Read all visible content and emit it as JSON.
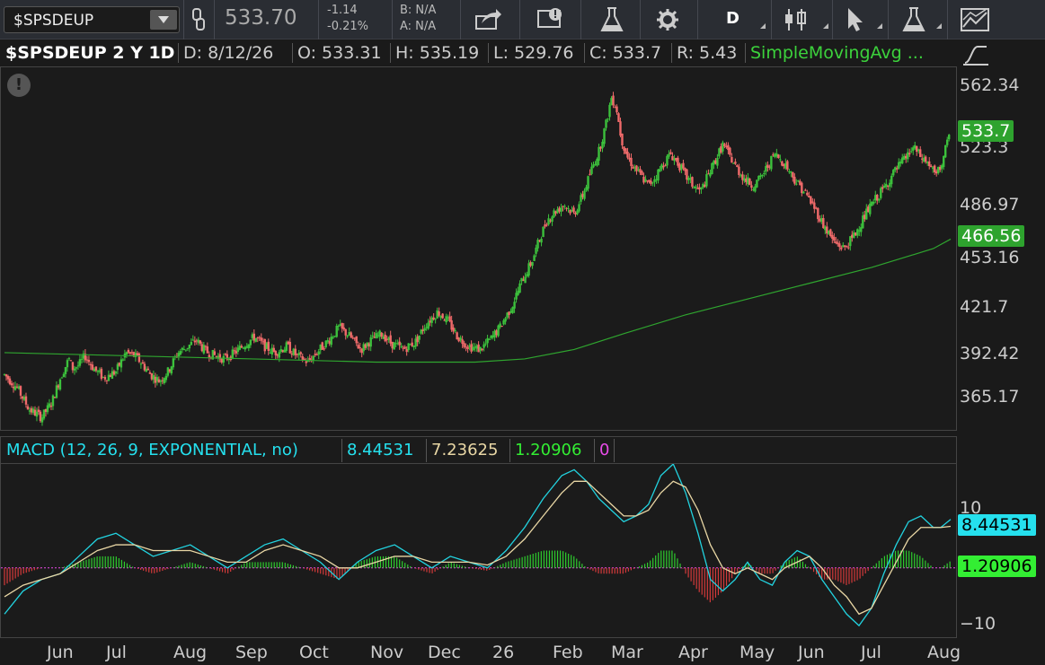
{
  "toolbar": {
    "symbol": "$SPSDEUP",
    "last_price": "533.70",
    "net_change": "-1.14",
    "pct_change": "-0.21%",
    "bid": "B: N/A",
    "ask": "A: N/A",
    "aggregation": "D"
  },
  "header": {
    "title": "$SPSDEUP 2 Y 1D",
    "date": "D: 8/12/26",
    "open": "O: 533.31",
    "high": "H: 535.19",
    "low": "L: 529.76",
    "close": "C: 533.7",
    "range": "R: 5.43",
    "study": "SimpleMovingAvg ..."
  },
  "macd": {
    "label": "MACD (12, 26, 9, EXPONENTIAL, no)",
    "value": "8.44531",
    "avg": "7.23625",
    "diff": "1.20906",
    "zero": "0"
  },
  "colors": {
    "up": "#3cc13c",
    "down": "#f06a6a",
    "sma": "#2fa52f",
    "macd_line": "#22d3e0",
    "macd_avg": "#e9d7a5",
    "cyan_text": "#25e0ee",
    "green_text": "#33ee33",
    "magenta_text": "#e94be9"
  },
  "chart_data": [
    {
      "type": "candlestick",
      "title": "$SPSDEUP 2 Y 1D",
      "y_ticks": [
        "562.34",
        "523.3",
        "486.97",
        "453.16",
        "421.7",
        "392.42",
        "365.17"
      ],
      "x_ticks": [
        "Jun",
        "Jul",
        "Aug",
        "Sep",
        "Oct",
        "Nov",
        "Dec",
        "26",
        "Feb",
        "Mar",
        "Apr",
        "May",
        "Jun",
        "Jul",
        "Aug"
      ],
      "last_price_label": "533.7",
      "sma_label": "466.56",
      "ylim": [
        345,
        575
      ],
      "close_path": [
        [
          0,
          380
        ],
        [
          10,
          372
        ],
        [
          20,
          358
        ],
        [
          30,
          353
        ],
        [
          38,
          362
        ],
        [
          45,
          378
        ],
        [
          52,
          390
        ],
        [
          55,
          384
        ],
        [
          60,
          386
        ],
        [
          65,
          392
        ],
        [
          72,
          384
        ],
        [
          80,
          378
        ],
        [
          90,
          382
        ],
        [
          98,
          394
        ],
        [
          105,
          392
        ],
        [
          110,
          388
        ],
        [
          118,
          380
        ],
        [
          125,
          376
        ],
        [
          132,
          382
        ],
        [
          140,
          394
        ],
        [
          148,
          398
        ],
        [
          155,
          402
        ],
        [
          162,
          395
        ],
        [
          170,
          392
        ],
        [
          178,
          390
        ],
        [
          186,
          394
        ],
        [
          195,
          400
        ],
        [
          202,
          404
        ],
        [
          210,
          398
        ],
        [
          218,
          394
        ],
        [
          228,
          398
        ],
        [
          236,
          392
        ],
        [
          245,
          388
        ],
        [
          252,
          394
        ],
        [
          262,
          402
        ],
        [
          270,
          410
        ],
        [
          278,
          405
        ],
        [
          288,
          396
        ],
        [
          296,
          402
        ],
        [
          305,
          406
        ],
        [
          312,
          400
        ],
        [
          322,
          396
        ],
        [
          332,
          401
        ],
        [
          340,
          412
        ],
        [
          350,
          420
        ],
        [
          358,
          414
        ],
        [
          366,
          404
        ],
        [
          375,
          398
        ],
        [
          384,
          396
        ],
        [
          392,
          402
        ],
        [
          400,
          410
        ],
        [
          410,
          424
        ],
        [
          418,
          440
        ],
        [
          426,
          452
        ],
        [
          432,
          466
        ],
        [
          438,
          478
        ],
        [
          445,
          484
        ],
        [
          452,
          488
        ],
        [
          460,
          482
        ],
        [
          467,
          494
        ],
        [
          474,
          510
        ],
        [
          480,
          522
        ],
        [
          486,
          540
        ],
        [
          490,
          556
        ],
        [
          494,
          550
        ],
        [
          498,
          530
        ],
        [
          503,
          518
        ],
        [
          508,
          512
        ],
        [
          514,
          506
        ],
        [
          520,
          500
        ],
        [
          526,
          506
        ],
        [
          532,
          514
        ],
        [
          538,
          520
        ],
        [
          544,
          514
        ],
        [
          550,
          506
        ],
        [
          556,
          500
        ],
        [
          562,
          496
        ],
        [
          568,
          506
        ],
        [
          574,
          516
        ],
        [
          580,
          526
        ],
        [
          586,
          518
        ],
        [
          592,
          510
        ],
        [
          598,
          504
        ],
        [
          604,
          500
        ],
        [
          610,
          504
        ],
        [
          616,
          512
        ],
        [
          622,
          520
        ],
        [
          630,
          514
        ],
        [
          638,
          504
        ],
        [
          646,
          496
        ],
        [
          654,
          486
        ],
        [
          662,
          474
        ],
        [
          670,
          464
        ],
        [
          678,
          460
        ],
        [
          686,
          468
        ],
        [
          694,
          480
        ],
        [
          702,
          490
        ],
        [
          710,
          498
        ],
        [
          718,
          508
        ],
        [
          726,
          516
        ],
        [
          734,
          524
        ],
        [
          740,
          518
        ],
        [
          746,
          514
        ],
        [
          752,
          506
        ],
        [
          756,
          512
        ],
        [
          760,
          524
        ],
        [
          764,
          532
        ]
      ],
      "sma_path": [
        [
          0,
          394
        ],
        [
          100,
          392
        ],
        [
          200,
          390
        ],
        [
          300,
          388
        ],
        [
          380,
          388
        ],
        [
          420,
          390
        ],
        [
          460,
          396
        ],
        [
          500,
          406
        ],
        [
          550,
          418
        ],
        [
          600,
          428
        ],
        [
          650,
          438
        ],
        [
          700,
          448
        ],
        [
          750,
          460
        ],
        [
          764,
          466
        ]
      ]
    },
    {
      "type": "line",
      "title": "MACD (12, 26, 9, EXPONENTIAL, no)",
      "y_ticks": [
        "10",
        "0",
        "-10"
      ],
      "ylim": [
        -12,
        18
      ],
      "series": [
        {
          "name": "8.44531",
          "values": [
            [
              0,
              -8
            ],
            [
              15,
              -4
            ],
            [
              30,
              -2
            ],
            [
              45,
              -1
            ],
            [
              60,
              2
            ],
            [
              75,
              5
            ],
            [
              90,
              6
            ],
            [
              105,
              4
            ],
            [
              120,
              2
            ],
            [
              135,
              3
            ],
            [
              150,
              4
            ],
            [
              165,
              2
            ],
            [
              180,
              0
            ],
            [
              195,
              2
            ],
            [
              210,
              4
            ],
            [
              225,
              5
            ],
            [
              240,
              3
            ],
            [
              255,
              1
            ],
            [
              270,
              -2
            ],
            [
              285,
              1
            ],
            [
              300,
              3
            ],
            [
              315,
              4
            ],
            [
              330,
              2
            ],
            [
              345,
              0
            ],
            [
              360,
              2
            ],
            [
              375,
              1
            ],
            [
              390,
              0
            ],
            [
              405,
              3
            ],
            [
              420,
              7
            ],
            [
              435,
              12
            ],
            [
              450,
              16
            ],
            [
              460,
              17
            ],
            [
              470,
              15
            ],
            [
              480,
              12
            ],
            [
              490,
              10
            ],
            [
              500,
              8
            ],
            [
              510,
              9
            ],
            [
              520,
              11
            ],
            [
              530,
              16
            ],
            [
              540,
              18
            ],
            [
              550,
              13
            ],
            [
              560,
              6
            ],
            [
              570,
              -2
            ],
            [
              580,
              -4
            ],
            [
              590,
              -2
            ],
            [
              600,
              1
            ],
            [
              610,
              -2
            ],
            [
              620,
              -3
            ],
            [
              630,
              1
            ],
            [
              640,
              3
            ],
            [
              650,
              2
            ],
            [
              660,
              -2
            ],
            [
              670,
              -5
            ],
            [
              680,
              -8
            ],
            [
              690,
              -10
            ],
            [
              700,
              -7
            ],
            [
              710,
              -1
            ],
            [
              720,
              4
            ],
            [
              730,
              8
            ],
            [
              740,
              9
            ],
            [
              750,
              7
            ],
            [
              756,
              7
            ],
            [
              764,
              8.4
            ]
          ]
        },
        {
          "name": "7.23625",
          "values": [
            [
              0,
              -5
            ],
            [
              15,
              -3
            ],
            [
              30,
              -2
            ],
            [
              45,
              -1
            ],
            [
              60,
              1
            ],
            [
              75,
              3
            ],
            [
              90,
              4
            ],
            [
              105,
              4
            ],
            [
              120,
              3
            ],
            [
              135,
              3
            ],
            [
              150,
              3
            ],
            [
              165,
              2
            ],
            [
              180,
              1
            ],
            [
              195,
              1
            ],
            [
              210,
              3
            ],
            [
              225,
              4
            ],
            [
              240,
              3
            ],
            [
              255,
              2
            ],
            [
              270,
              0
            ],
            [
              285,
              0
            ],
            [
              300,
              1
            ],
            [
              315,
              2
            ],
            [
              330,
              2
            ],
            [
              345,
              1
            ],
            [
              360,
              1
            ],
            [
              375,
              1
            ],
            [
              390,
              0.5
            ],
            [
              405,
              2
            ],
            [
              420,
              5
            ],
            [
              435,
              9
            ],
            [
              450,
              13
            ],
            [
              460,
              15
            ],
            [
              470,
              15
            ],
            [
              480,
              13
            ],
            [
              490,
              11
            ],
            [
              500,
              9
            ],
            [
              510,
              9
            ],
            [
              520,
              10
            ],
            [
              530,
              13
            ],
            [
              540,
              15
            ],
            [
              550,
              14
            ],
            [
              560,
              10
            ],
            [
              570,
              4
            ],
            [
              580,
              0
            ],
            [
              590,
              -1
            ],
            [
              600,
              0
            ],
            [
              610,
              -1
            ],
            [
              620,
              -2
            ],
            [
              630,
              0
            ],
            [
              640,
              1
            ],
            [
              650,
              2
            ],
            [
              660,
              0
            ],
            [
              670,
              -3
            ],
            [
              680,
              -5
            ],
            [
              690,
              -8
            ],
            [
              700,
              -7
            ],
            [
              710,
              -3
            ],
            [
              720,
              1
            ],
            [
              730,
              5
            ],
            [
              740,
              7
            ],
            [
              750,
              7
            ],
            [
              756,
              7
            ],
            [
              764,
              7.2
            ]
          ]
        }
      ]
    }
  ]
}
